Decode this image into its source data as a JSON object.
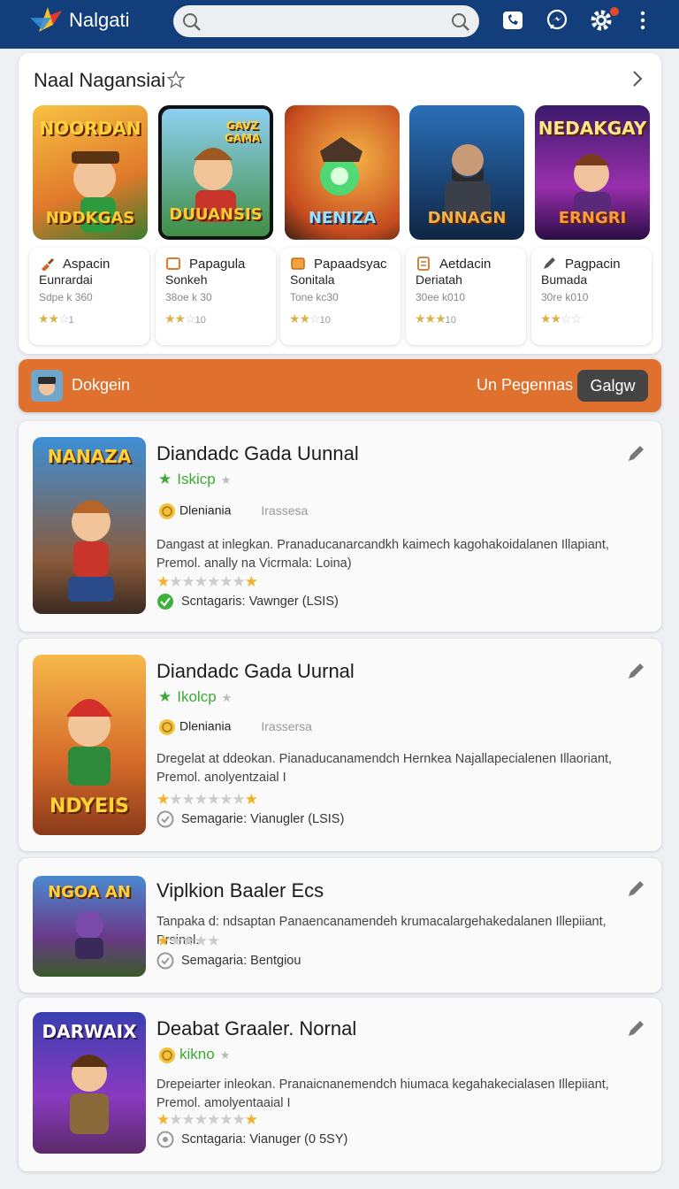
{
  "topbar": {
    "brand": "Nalgati",
    "search_placeholder": ""
  },
  "featured": {
    "title": "Naal Nagansiai",
    "games": [
      {
        "art_title": "NOORDAN",
        "art_sub": "NDDKGAS",
        "name1": "Aspacin",
        "name2": "Eunrardai",
        "meta": "Sdpe k 360",
        "stars": 2,
        "count": "1"
      },
      {
        "art_title": "GAVZ GAMA",
        "art_sub": "DUUANSIS",
        "name1": "Papagula",
        "name2": "Sonkeh",
        "meta": "38oe k 30",
        "stars": 2,
        "count": "10"
      },
      {
        "art_title": "",
        "art_sub": "NENIZA",
        "name1": "Papaadsyac",
        "name2": "Sonitala",
        "meta": "Tone kc30",
        "stars": 2,
        "count": "10"
      },
      {
        "art_title": "",
        "art_sub": "DNNAGN",
        "name1": "Aetdacin",
        "name2": "Deriatah",
        "meta": "30ee k010",
        "stars": 3,
        "count": "10"
      },
      {
        "art_title": "NEDAKGAY",
        "art_sub": "ERNGRI",
        "name1": "Pagpacin",
        "name2": "Bumada",
        "meta": "30re k010",
        "stars": 2,
        "count": ""
      }
    ]
  },
  "banner": {
    "label": "Dokgein",
    "right_text": "Un Pegennas",
    "button": "Galgw"
  },
  "list": [
    {
      "art_title": "NANAZA",
      "title": "Diandadc Gada Uunnal",
      "tag": "Iskicp",
      "dev": "Dleniania",
      "dev2": "Irassesa",
      "desc": "Dangast at inlegkan. Pranaducanarcandkh kaimech kagohakoidalanen Illapiant, Premol. anally na Vicrmala: Loina)",
      "stars": 1,
      "stars_end": 1,
      "status": "Scntagaris: Vawnger (LSIS)",
      "status_color": "#3db23a"
    },
    {
      "art_title": "NDYEIS",
      "title": "Diandadc Gada Uurnal",
      "tag": "Ikolcp",
      "dev": "Dleniania",
      "dev2": "Irassersa",
      "desc": "Dregelat at ddeokan. Pianaducanamendch Hernkea Najallapecialenen Illaoriant, Premol. anolyentzaial I",
      "stars": 1,
      "stars_end": 1,
      "status": "Semagarie: Vianugler (LSIS)",
      "status_color": "#999"
    },
    {
      "art_title": "NGOA AN",
      "title": "Viplkion Baaler Ecs",
      "tag": "",
      "dev": "",
      "dev2": "",
      "desc": "Tanpaka d: ndsaptan Panaencanamendeh krumacalargehakedalanen Illepiiant, Prsinol.",
      "stars": 1,
      "stars_end": 0,
      "status": "Semagaria: Bentgiou",
      "status_color": "#999"
    },
    {
      "art_title": "DARWAIX",
      "title": "Deabat Graaler. Nornal",
      "tag": "kikno",
      "dev": "",
      "dev2": "",
      "desc": "Drepeiarter inleokan. Pranaicnanemendch hiumaca kegahakecialasen Illepiiant, Premol. amolyentaaial I",
      "stars": 1,
      "stars_end": 1,
      "status": "Scntagaria: Vianuger (0 5SY)",
      "status_color": "#999"
    }
  ],
  "colors": {
    "topbar": "#123f7c",
    "banner": "#e0702e",
    "tag_green": "#3da935",
    "star": "#f3b12a"
  }
}
